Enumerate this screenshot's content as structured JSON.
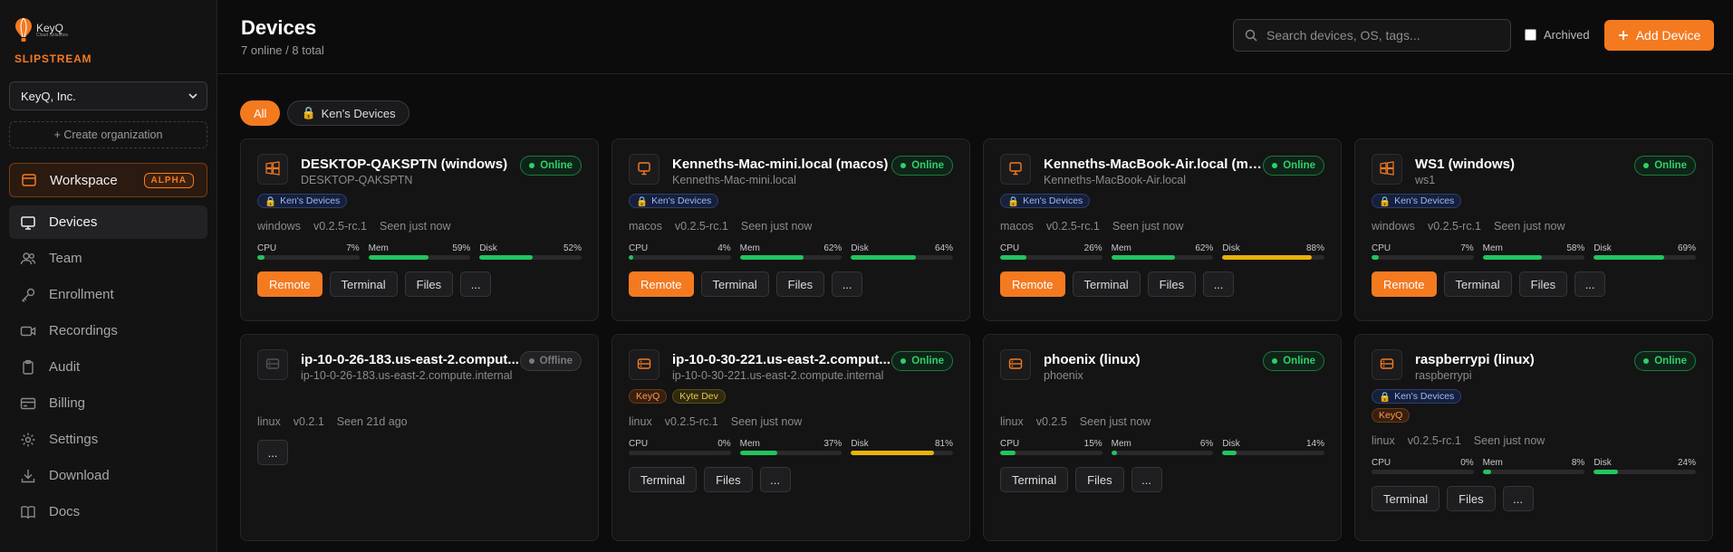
{
  "brand": {
    "logo_text": "KeyQ",
    "logo_sub": "Cloud Solutions",
    "product": "SLIPSTREAM",
    "accent": "#f47a20"
  },
  "sidebar": {
    "org": "KeyQ, Inc.",
    "create_org": "+ Create organization",
    "workspace": {
      "label": "Workspace",
      "badge": "ALPHA"
    },
    "items": [
      {
        "label": "Devices",
        "icon": "monitor-icon",
        "active": true
      },
      {
        "label": "Team",
        "icon": "users-icon"
      },
      {
        "label": "Enrollment",
        "icon": "key-icon"
      },
      {
        "label": "Recordings",
        "icon": "video-icon"
      },
      {
        "label": "Audit",
        "icon": "clipboard-icon"
      },
      {
        "label": "Billing",
        "icon": "credit-card-icon"
      },
      {
        "label": "Settings",
        "icon": "gear-icon"
      },
      {
        "label": "Download",
        "icon": "download-icon"
      },
      {
        "label": "Docs",
        "icon": "book-icon"
      }
    ]
  },
  "header": {
    "title": "Devices",
    "subtitle": "7 online / 8 total",
    "search_placeholder": "Search devices, OS, tags...",
    "archived_label": "Archived",
    "add_label": "Add Device"
  },
  "filters": [
    "All",
    "Ken's Devices"
  ],
  "metric_labels": {
    "cpu": "CPU",
    "mem": "Mem",
    "disk": "Disk"
  },
  "actions": {
    "remote": "Remote",
    "terminal": "Terminal",
    "files": "Files",
    "more": "..."
  },
  "status_labels": {
    "online": "Online",
    "offline": "Offline"
  },
  "devices": [
    {
      "name": "DESKTOP-QAKSPTN (windows)",
      "host": "DESKTOP-QAKSPTN",
      "icon": "windows-icon",
      "status": "online",
      "tags": [
        "Ken's Devices"
      ],
      "os": "windows",
      "version": "v0.2.5-rc.1",
      "seen": "Seen just now",
      "cpu": "7%",
      "mem": "59%",
      "disk": "52%",
      "remote": true
    },
    {
      "name": "Kenneths-Mac-mini.local (macos)",
      "host": "Kenneths-Mac-mini.local",
      "icon": "monitor-icon",
      "status": "online",
      "tags": [
        "Ken's Devices"
      ],
      "os": "macos",
      "version": "v0.2.5-rc.1",
      "seen": "Seen just now",
      "cpu": "4%",
      "mem": "62%",
      "disk": "64%",
      "remote": true
    },
    {
      "name": "Kenneths-MacBook-Air.local (ma...",
      "host": "Kenneths-MacBook-Air.local",
      "icon": "monitor-icon",
      "status": "online",
      "tags": [
        "Ken's Devices"
      ],
      "os": "macos",
      "version": "v0.2.5-rc.1",
      "seen": "Seen just now",
      "cpu": "26%",
      "mem": "62%",
      "disk": "88%",
      "remote": true
    },
    {
      "name": "WS1 (windows)",
      "host": "ws1",
      "icon": "windows-icon",
      "status": "online",
      "tags": [
        "Ken's Devices"
      ],
      "os": "windows",
      "version": "v0.2.5-rc.1",
      "seen": "Seen just now",
      "cpu": "7%",
      "mem": "58%",
      "disk": "69%",
      "remote": true
    },
    {
      "name": "ip-10-0-26-183.us-east-2.comput...",
      "host": "ip-10-0-26-183.us-east-2.compute.internal",
      "icon": "server-icon",
      "status": "offline",
      "tags": [],
      "os": "linux",
      "version": "v0.2.1",
      "seen": "Seen 21d ago"
    },
    {
      "name": "ip-10-0-30-221.us-east-2.comput...",
      "host": "ip-10-0-30-221.us-east-2.compute.internal",
      "icon": "server-icon",
      "status": "online",
      "tags": [
        "KeyQ",
        "Kyte Dev"
      ],
      "os": "linux",
      "version": "v0.2.5-rc.1",
      "seen": "Seen just now",
      "cpu": "0%",
      "mem": "37%",
      "disk": "81%"
    },
    {
      "name": "phoenix (linux)",
      "host": "phoenix",
      "icon": "server-icon",
      "status": "online",
      "tags": [],
      "os": "linux",
      "version": "v0.2.5",
      "seen": "Seen just now",
      "cpu": "15%",
      "mem": "6%",
      "disk": "14%"
    },
    {
      "name": "raspberrypi (linux)",
      "host": "raspberrypi",
      "icon": "server-icon",
      "status": "online",
      "tags": [
        "Ken's Devices",
        "KeyQ"
      ],
      "os": "linux",
      "version": "v0.2.5-rc.1",
      "seen": "Seen just now",
      "cpu": "0%",
      "mem": "8%",
      "disk": "24%"
    }
  ]
}
